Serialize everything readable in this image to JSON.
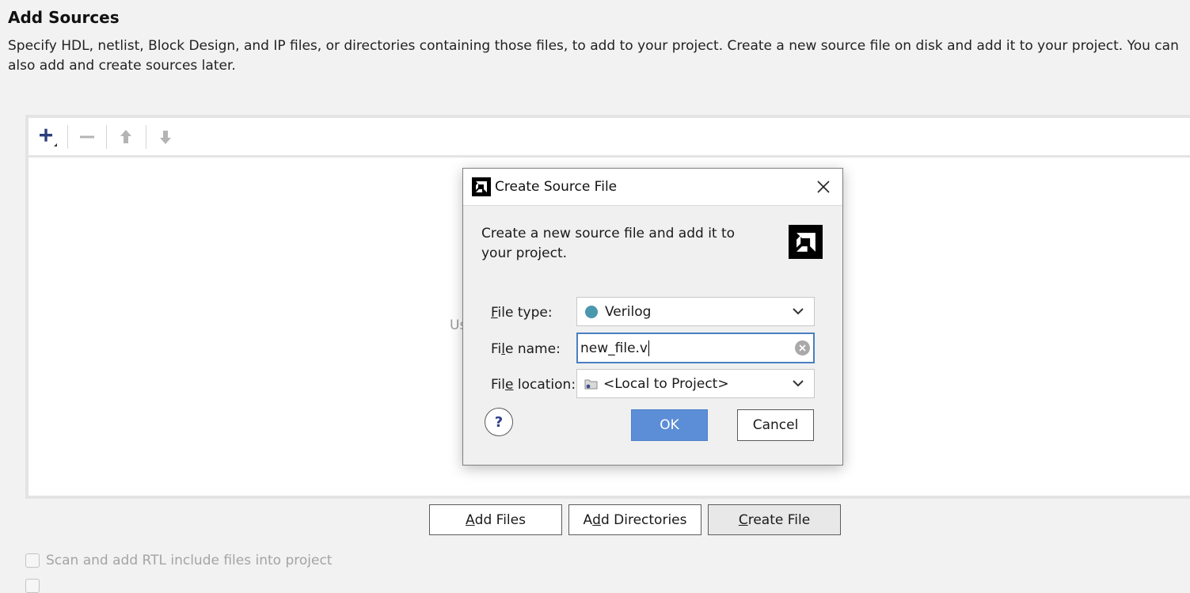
{
  "page": {
    "title": "Add Sources",
    "description": "Specify HDL, netlist, Block Design, and IP files, or directories containing those files, to add to your project. Create a new source file on disk and add it to your project. You can also add and create sources later."
  },
  "list": {
    "hint_partial": "Us"
  },
  "buttons": {
    "add_files": {
      "u": "A",
      "rest": "dd Files"
    },
    "add_directories": {
      "pre": "A",
      "u": "d",
      "rest": "d Directories"
    },
    "create_file": {
      "u": "C",
      "rest": "reate File"
    }
  },
  "options": {
    "scan_rtl": "Scan and add RTL include files into project"
  },
  "dialog": {
    "title": "Create Source File",
    "description": "Create a new source file and add it to your project.",
    "file_type": {
      "label_u": "F",
      "label_rest": "ile type:",
      "value": "Verilog"
    },
    "file_name": {
      "label_pre": "Fi",
      "label_u": "l",
      "label_rest": "e name:",
      "value": "new_file.v"
    },
    "file_location": {
      "label_pre": "Fil",
      "label_u": "e",
      "label_rest": " location:",
      "value": "<Local to Project>"
    },
    "ok": "OK",
    "cancel": "Cancel",
    "help": "?"
  },
  "colors": {
    "accent": "#5b8ed6",
    "verilog_dot": "#4b97ad",
    "focus_border": "#4a7fc1"
  },
  "icons": [
    "add-icon",
    "remove-icon",
    "move-up-icon",
    "move-down-icon",
    "close-icon",
    "chevron-down-icon",
    "folder-icon",
    "clear-icon",
    "help-icon",
    "amd-logo-icon"
  ]
}
